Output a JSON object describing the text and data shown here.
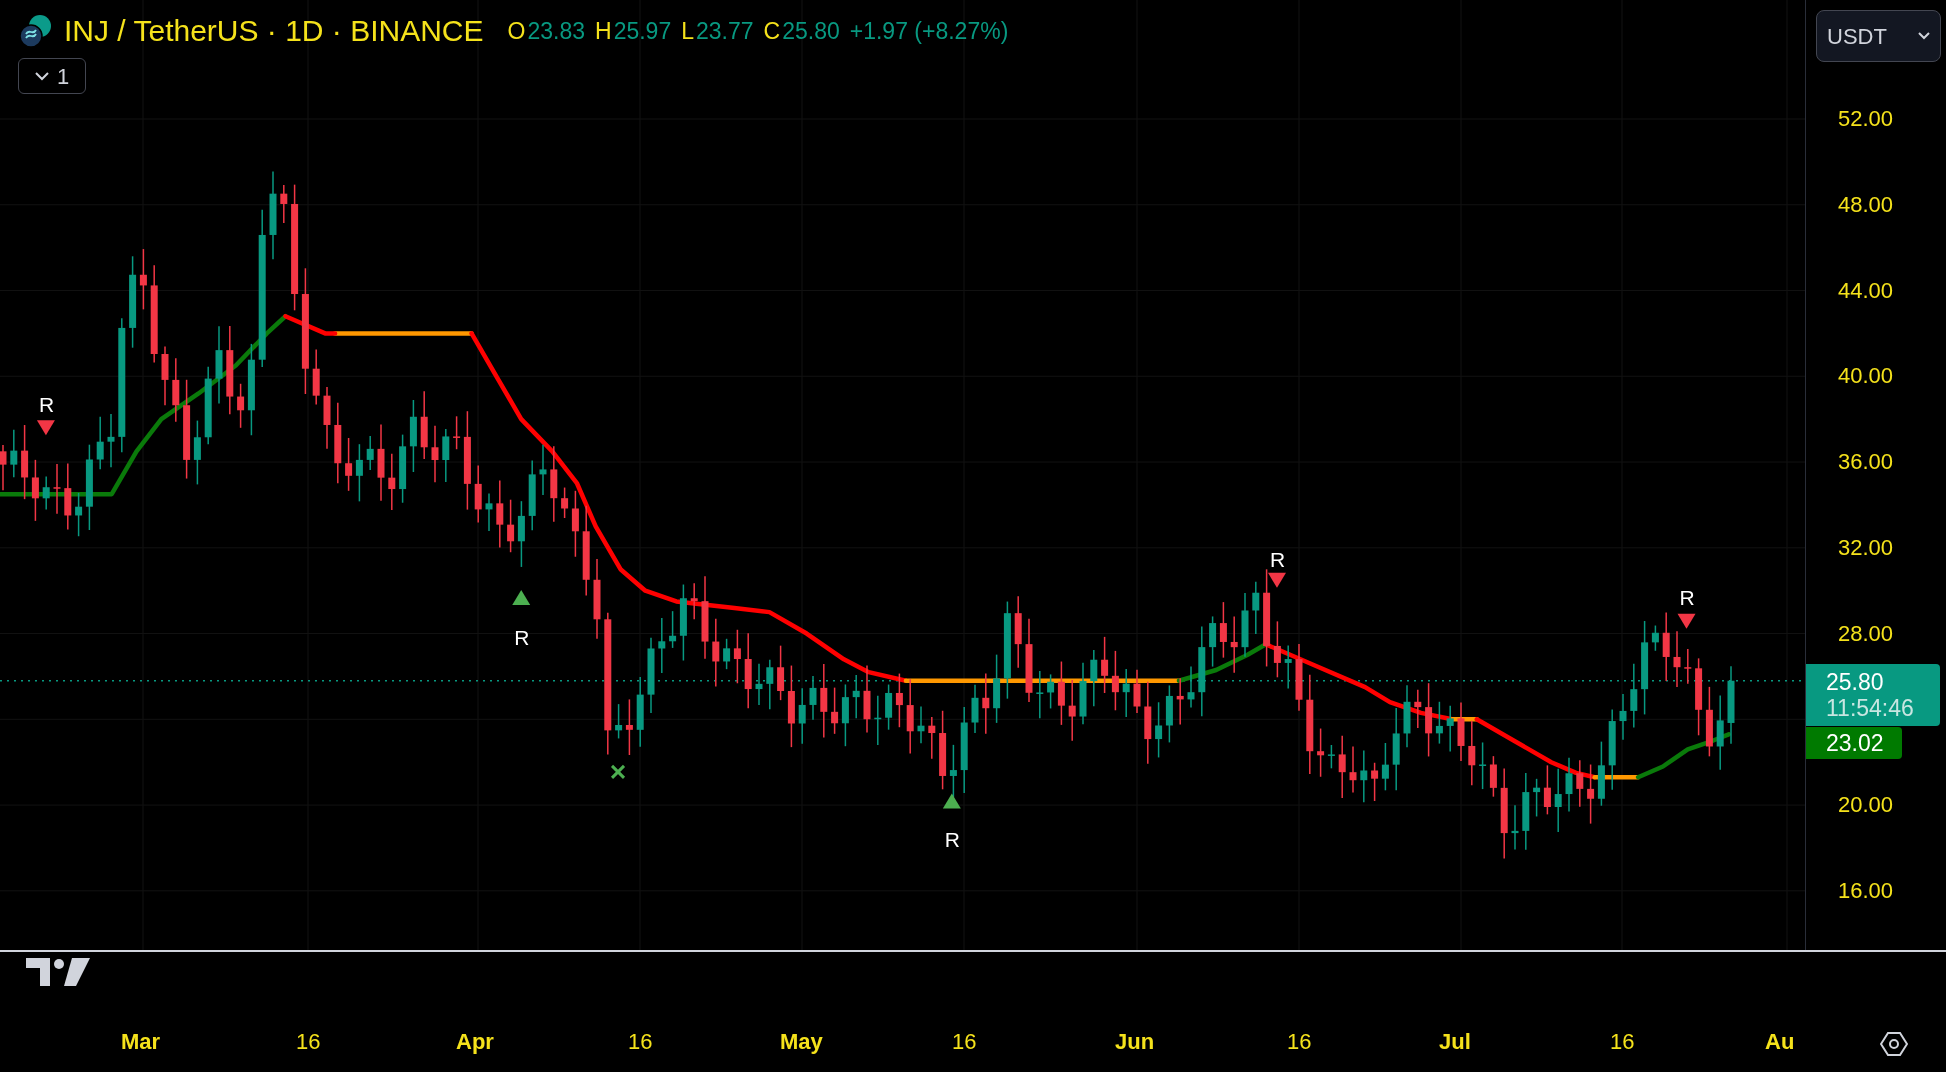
{
  "header": {
    "symbol": "INJ / TetherUS · 1D · BINANCE",
    "ohlc": [
      {
        "label": "O",
        "value": "23.83"
      },
      {
        "label": "H",
        "value": "25.97"
      },
      {
        "label": "L",
        "value": "23.77"
      },
      {
        "label": "C",
        "value": "25.80"
      }
    ],
    "change": "+1.97 (+8.27%)"
  },
  "indicator_toggle": {
    "count": "1"
  },
  "currency_select": {
    "value": "USDT"
  },
  "price_axis": {
    "labels": [
      "52.00",
      "48.00",
      "44.00",
      "40.00",
      "36.00",
      "32.00",
      "28.00",
      "20.00",
      "16.00"
    ],
    "last_price": "25.80",
    "countdown": "11:54:46",
    "indicator_value": "23.02"
  },
  "signals": [
    {
      "kind": "sell",
      "label": "R"
    },
    {
      "kind": "buy",
      "label": "R"
    },
    {
      "kind": "cross"
    },
    {
      "kind": "buy",
      "label": "R"
    },
    {
      "kind": "sell",
      "label": "R"
    },
    {
      "kind": "sell",
      "label": "R"
    }
  ],
  "time_axis": {
    "labels": [
      {
        "text": "Mar",
        "kind": "month"
      },
      {
        "text": "16",
        "kind": "day"
      },
      {
        "text": "Apr",
        "kind": "month"
      },
      {
        "text": "16",
        "kind": "day"
      },
      {
        "text": "May",
        "kind": "month"
      },
      {
        "text": "16",
        "kind": "day"
      },
      {
        "text": "Jun",
        "kind": "month"
      },
      {
        "text": "16",
        "kind": "day"
      },
      {
        "text": "Jul",
        "kind": "month"
      },
      {
        "text": "16",
        "kind": "day"
      },
      {
        "text": "Au",
        "kind": "month"
      }
    ]
  }
}
